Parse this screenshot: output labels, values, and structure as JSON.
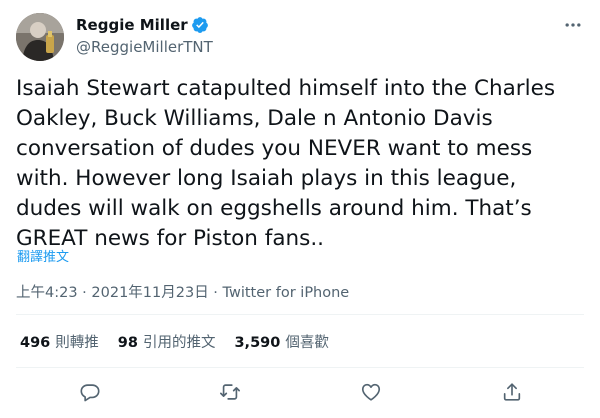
{
  "author": {
    "display_name": "Reggie Miller",
    "handle": "@ReggieMillerTNT",
    "verified": true,
    "avatar_icon": "profile-photo",
    "verified_icon": "verified-badge-icon"
  },
  "tweet": {
    "text": "Isaiah Stewart catapulted himself into the Charles Oakley, Buck Williams, Dale n Antonio Davis conversation of dudes you NEVER want to mess with. However long Isaiah plays in this league, dudes will walk on eggshells around him. That’s GREAT news for Piston fans..",
    "translate_label": "翻譯推文"
  },
  "meta": {
    "time": "上午4:23",
    "separator": " · ",
    "date": "2021年11月23日",
    "source": "Twitter for iPhone"
  },
  "stats": {
    "retweets": {
      "count": "496",
      "label": "則轉推"
    },
    "quotes": {
      "count": "98",
      "label": "引用的推文"
    },
    "likes": {
      "count": "3,590",
      "label": "個喜歡"
    }
  },
  "actions": {
    "reply_icon": "reply-icon",
    "retweet_icon": "retweet-icon",
    "like_icon": "heart-icon",
    "share_icon": "share-icon"
  },
  "colors": {
    "accent": "#1d9bf0",
    "text_primary": "#0f1419",
    "text_secondary": "#536471",
    "divider": "#eff3f4"
  }
}
